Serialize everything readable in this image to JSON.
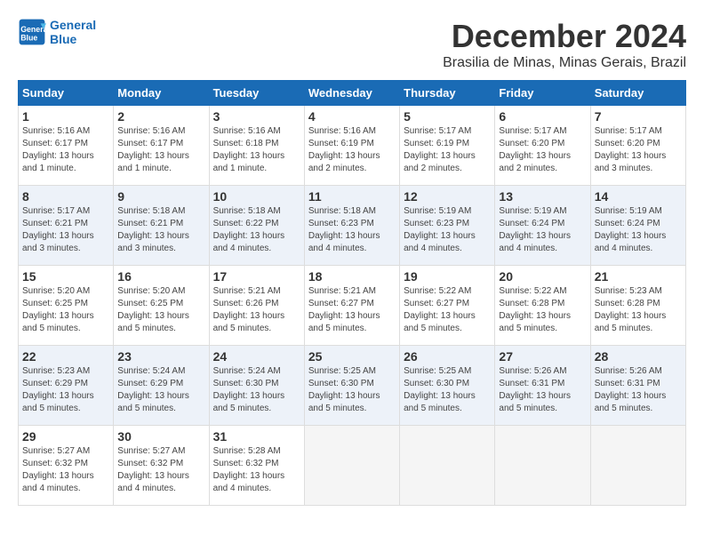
{
  "logo": {
    "line1": "General",
    "line2": "Blue"
  },
  "title": "December 2024",
  "location": "Brasilia de Minas, Minas Gerais, Brazil",
  "headers": [
    "Sunday",
    "Monday",
    "Tuesday",
    "Wednesday",
    "Thursday",
    "Friday",
    "Saturday"
  ],
  "weeks": [
    [
      {
        "day": "1",
        "info": "Sunrise: 5:16 AM\nSunset: 6:17 PM\nDaylight: 13 hours\nand 1 minute."
      },
      {
        "day": "2",
        "info": "Sunrise: 5:16 AM\nSunset: 6:17 PM\nDaylight: 13 hours\nand 1 minute."
      },
      {
        "day": "3",
        "info": "Sunrise: 5:16 AM\nSunset: 6:18 PM\nDaylight: 13 hours\nand 1 minute."
      },
      {
        "day": "4",
        "info": "Sunrise: 5:16 AM\nSunset: 6:19 PM\nDaylight: 13 hours\nand 2 minutes."
      },
      {
        "day": "5",
        "info": "Sunrise: 5:17 AM\nSunset: 6:19 PM\nDaylight: 13 hours\nand 2 minutes."
      },
      {
        "day": "6",
        "info": "Sunrise: 5:17 AM\nSunset: 6:20 PM\nDaylight: 13 hours\nand 2 minutes."
      },
      {
        "day": "7",
        "info": "Sunrise: 5:17 AM\nSunset: 6:20 PM\nDaylight: 13 hours\nand 3 minutes."
      }
    ],
    [
      {
        "day": "8",
        "info": "Sunrise: 5:17 AM\nSunset: 6:21 PM\nDaylight: 13 hours\nand 3 minutes."
      },
      {
        "day": "9",
        "info": "Sunrise: 5:18 AM\nSunset: 6:21 PM\nDaylight: 13 hours\nand 3 minutes."
      },
      {
        "day": "10",
        "info": "Sunrise: 5:18 AM\nSunset: 6:22 PM\nDaylight: 13 hours\nand 4 minutes."
      },
      {
        "day": "11",
        "info": "Sunrise: 5:18 AM\nSunset: 6:23 PM\nDaylight: 13 hours\nand 4 minutes."
      },
      {
        "day": "12",
        "info": "Sunrise: 5:19 AM\nSunset: 6:23 PM\nDaylight: 13 hours\nand 4 minutes."
      },
      {
        "day": "13",
        "info": "Sunrise: 5:19 AM\nSunset: 6:24 PM\nDaylight: 13 hours\nand 4 minutes."
      },
      {
        "day": "14",
        "info": "Sunrise: 5:19 AM\nSunset: 6:24 PM\nDaylight: 13 hours\nand 4 minutes."
      }
    ],
    [
      {
        "day": "15",
        "info": "Sunrise: 5:20 AM\nSunset: 6:25 PM\nDaylight: 13 hours\nand 5 minutes."
      },
      {
        "day": "16",
        "info": "Sunrise: 5:20 AM\nSunset: 6:25 PM\nDaylight: 13 hours\nand 5 minutes."
      },
      {
        "day": "17",
        "info": "Sunrise: 5:21 AM\nSunset: 6:26 PM\nDaylight: 13 hours\nand 5 minutes."
      },
      {
        "day": "18",
        "info": "Sunrise: 5:21 AM\nSunset: 6:27 PM\nDaylight: 13 hours\nand 5 minutes."
      },
      {
        "day": "19",
        "info": "Sunrise: 5:22 AM\nSunset: 6:27 PM\nDaylight: 13 hours\nand 5 minutes."
      },
      {
        "day": "20",
        "info": "Sunrise: 5:22 AM\nSunset: 6:28 PM\nDaylight: 13 hours\nand 5 minutes."
      },
      {
        "day": "21",
        "info": "Sunrise: 5:23 AM\nSunset: 6:28 PM\nDaylight: 13 hours\nand 5 minutes."
      }
    ],
    [
      {
        "day": "22",
        "info": "Sunrise: 5:23 AM\nSunset: 6:29 PM\nDaylight: 13 hours\nand 5 minutes."
      },
      {
        "day": "23",
        "info": "Sunrise: 5:24 AM\nSunset: 6:29 PM\nDaylight: 13 hours\nand 5 minutes."
      },
      {
        "day": "24",
        "info": "Sunrise: 5:24 AM\nSunset: 6:30 PM\nDaylight: 13 hours\nand 5 minutes."
      },
      {
        "day": "25",
        "info": "Sunrise: 5:25 AM\nSunset: 6:30 PM\nDaylight: 13 hours\nand 5 minutes."
      },
      {
        "day": "26",
        "info": "Sunrise: 5:25 AM\nSunset: 6:30 PM\nDaylight: 13 hours\nand 5 minutes."
      },
      {
        "day": "27",
        "info": "Sunrise: 5:26 AM\nSunset: 6:31 PM\nDaylight: 13 hours\nand 5 minutes."
      },
      {
        "day": "28",
        "info": "Sunrise: 5:26 AM\nSunset: 6:31 PM\nDaylight: 13 hours\nand 5 minutes."
      }
    ],
    [
      {
        "day": "29",
        "info": "Sunrise: 5:27 AM\nSunset: 6:32 PM\nDaylight: 13 hours\nand 4 minutes."
      },
      {
        "day": "30",
        "info": "Sunrise: 5:27 AM\nSunset: 6:32 PM\nDaylight: 13 hours\nand 4 minutes."
      },
      {
        "day": "31",
        "info": "Sunrise: 5:28 AM\nSunset: 6:32 PM\nDaylight: 13 hours\nand 4 minutes."
      },
      {
        "day": "",
        "info": ""
      },
      {
        "day": "",
        "info": ""
      },
      {
        "day": "",
        "info": ""
      },
      {
        "day": "",
        "info": ""
      }
    ]
  ]
}
